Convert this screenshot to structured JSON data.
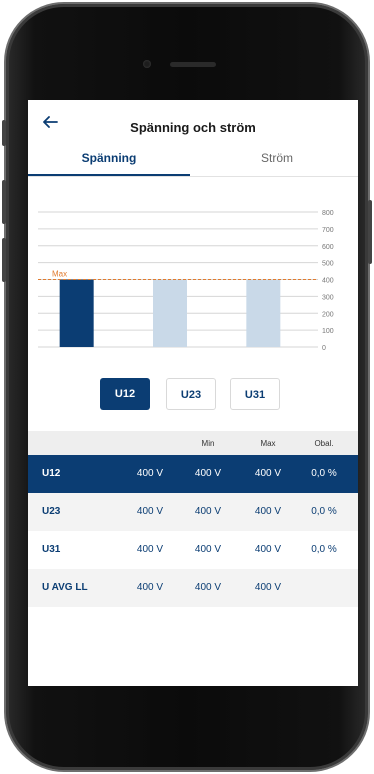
{
  "header": {
    "title": "Spänning och ström"
  },
  "tabs": [
    {
      "label": "Spänning",
      "active": true
    },
    {
      "label": "Ström",
      "active": false
    }
  ],
  "chart_data": {
    "type": "bar",
    "categories": [
      "U12",
      "U23",
      "U31"
    ],
    "values": [
      400,
      400,
      400
    ],
    "ylim": [
      0,
      800
    ],
    "y_ticks": [
      "800",
      "700",
      "600",
      "500",
      "400",
      "300",
      "200",
      "100",
      "0"
    ],
    "max_line_value": 400,
    "max_label": "Max",
    "bar_colors": [
      "#0b3d73",
      "#c9d9e8",
      "#c9d9e8"
    ]
  },
  "selector": {
    "buttons": [
      "U12",
      "U23",
      "U31"
    ],
    "selected": "U12"
  },
  "table": {
    "headers": {
      "name": "",
      "value": "",
      "min": "Min",
      "max": "Max",
      "unbalance": "Obal."
    },
    "rows": [
      {
        "name": "U12",
        "value": "400 V",
        "min": "400 V",
        "max": "400 V",
        "unbalance": "0,0 %"
      },
      {
        "name": "U23",
        "value": "400 V",
        "min": "400 V",
        "max": "400 V",
        "unbalance": "0,0 %"
      },
      {
        "name": "U31",
        "value": "400 V",
        "min": "400 V",
        "max": "400 V",
        "unbalance": "0,0 %"
      },
      {
        "name": "U AVG LL",
        "value": "400 V",
        "min": "400 V",
        "max": "400 V",
        "unbalance": ""
      }
    ]
  },
  "colors": {
    "primary": "#0b3d73",
    "bar_light": "#c9d9e8",
    "max_line": "#e07b2f"
  },
  "icons": {
    "back": "arrow-left-icon"
  }
}
